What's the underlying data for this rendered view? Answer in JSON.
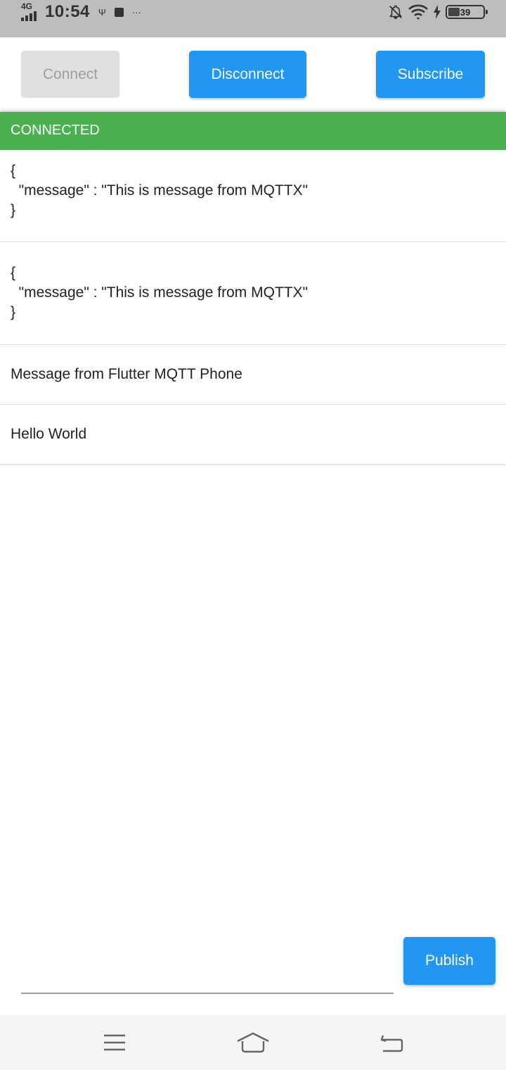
{
  "status_bar": {
    "network": "4G",
    "time": "10:54",
    "usb_glyph": "Ψ",
    "more_glyph": "···",
    "battery_level": 39,
    "battery_label": "39",
    "icons": [
      "signal-icon",
      "usb-icon",
      "notification-app-icon",
      "more-icon",
      "bell-off-icon",
      "wifi-icon",
      "charging-icon",
      "battery-icon"
    ]
  },
  "toolbar": {
    "connect_label": "Connect",
    "disconnect_label": "Disconnect",
    "subscribe_label": "Subscribe"
  },
  "connection": {
    "status": "CONNECTED",
    "color": "#4caf50"
  },
  "messages": [
    {
      "text": "{\n  \"message\" : \"This is message from MQTTX\"\n}"
    },
    {
      "text": "{\n  \"message\" : \"This is message from MQTTX\"\n}"
    },
    {
      "text": "Message from Flutter MQTT Phone"
    },
    {
      "text": "Hello World"
    }
  ],
  "publish": {
    "input_value": "",
    "button_label": "Publish"
  },
  "nav_bar": {
    "icons": [
      "menu-icon",
      "home-icon",
      "back-icon"
    ]
  },
  "colors": {
    "accent": "#2196f3",
    "disabled_bg": "#e0e0e0",
    "disabled_text": "#9e9e9e",
    "status_bar": "#bdbdbd",
    "nav_bar": "#f5f5f5"
  }
}
